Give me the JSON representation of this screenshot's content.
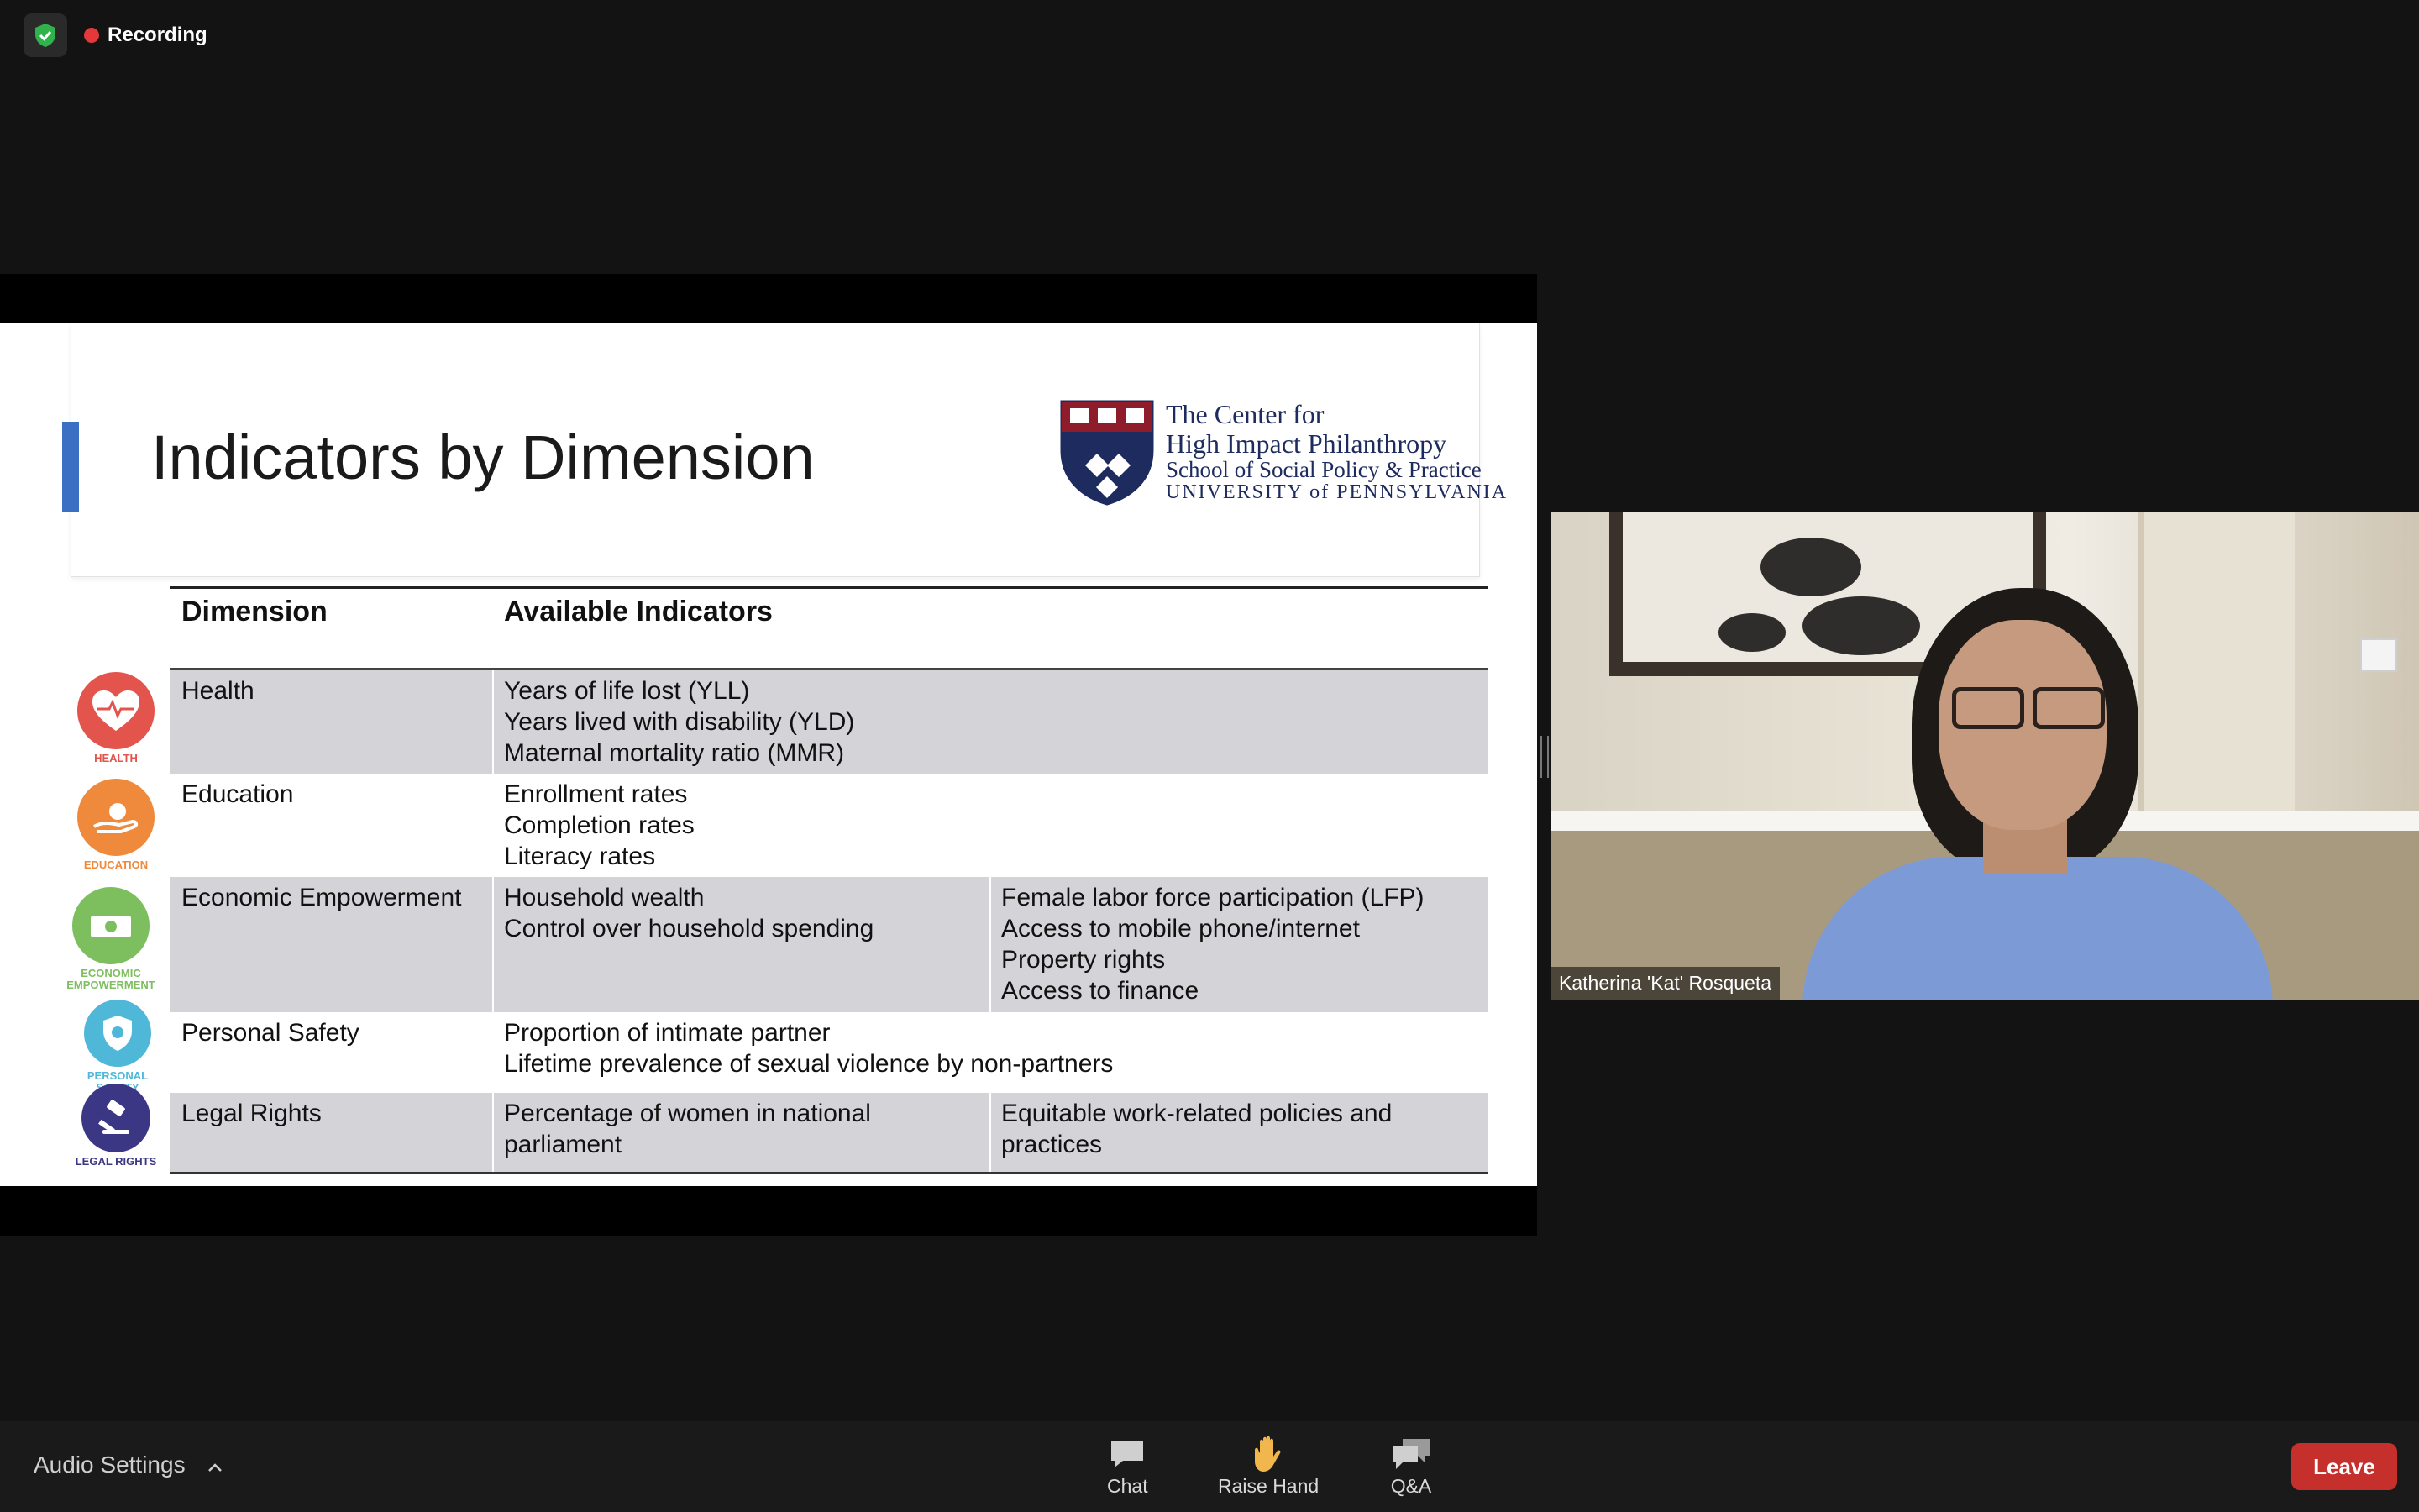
{
  "status": {
    "recording_label": "Recording"
  },
  "slide": {
    "title": "Indicators by Dimension",
    "logo": {
      "line1": "The Center for",
      "line2": "High Impact Philanthropy",
      "line3": "School of Social Policy & Practice",
      "line4": "UNIVERSITY of PENNSYLVANIA"
    },
    "table": {
      "headers": [
        "Dimension",
        "Available Indicators"
      ],
      "rows": [
        {
          "dimension": "Health",
          "col2": [
            "Years of life lost (YLL)",
            "Years lived with disability (YLD)",
            "Maternal mortality ratio (MMR)"
          ],
          "col3": []
        },
        {
          "dimension": "Education",
          "col2": [
            "Enrollment rates",
            "Completion rates",
            "Literacy rates"
          ],
          "col3": []
        },
        {
          "dimension": "Economic Empowerment",
          "col2": [
            "Household wealth",
            "Control over household spending"
          ],
          "col3": [
            "Female labor force participation (LFP)",
            "Access to mobile phone/internet",
            "Property rights",
            "Access to finance"
          ]
        },
        {
          "dimension": "Personal Safety",
          "col2": [
            "Proportion of intimate partner",
            "Lifetime prevalence of sexual violence by non-partners"
          ],
          "col3": []
        },
        {
          "dimension": "Legal Rights",
          "col2": [
            "Percentage of women in national",
            "parliament"
          ],
          "col3": [
            "Equitable work-related policies and",
            "practices"
          ]
        }
      ]
    },
    "icons": [
      {
        "caption": "HEALTH",
        "color": "#e2544c",
        "icon": "heart-pulse-icon"
      },
      {
        "caption": "EDUCATION",
        "color": "#ef8a3c",
        "icon": "apple-hand-icon"
      },
      {
        "caption": "ECONOMIC EMPOWERMENT",
        "color": "#7dbf5f",
        "icon": "money-icon"
      },
      {
        "caption": "PERSONAL SAFETY",
        "color": "#4fb8d9",
        "icon": "shield-icon"
      },
      {
        "caption": "LEGAL RIGHTS",
        "color": "#3b3784",
        "icon": "gavel-icon"
      }
    ]
  },
  "video": {
    "participant_name": "Katherina 'Kat' Rosqueta"
  },
  "toolbar": {
    "audio_settings": "Audio Settings",
    "chat": "Chat",
    "raise_hand": "Raise Hand",
    "qa": "Q&A",
    "leave": "Leave"
  },
  "colors": {
    "leave": "#c5302c",
    "accent": "#3a6fc4",
    "row_shade": "#d4d3d8",
    "logo_text": "#1d2b5e"
  }
}
